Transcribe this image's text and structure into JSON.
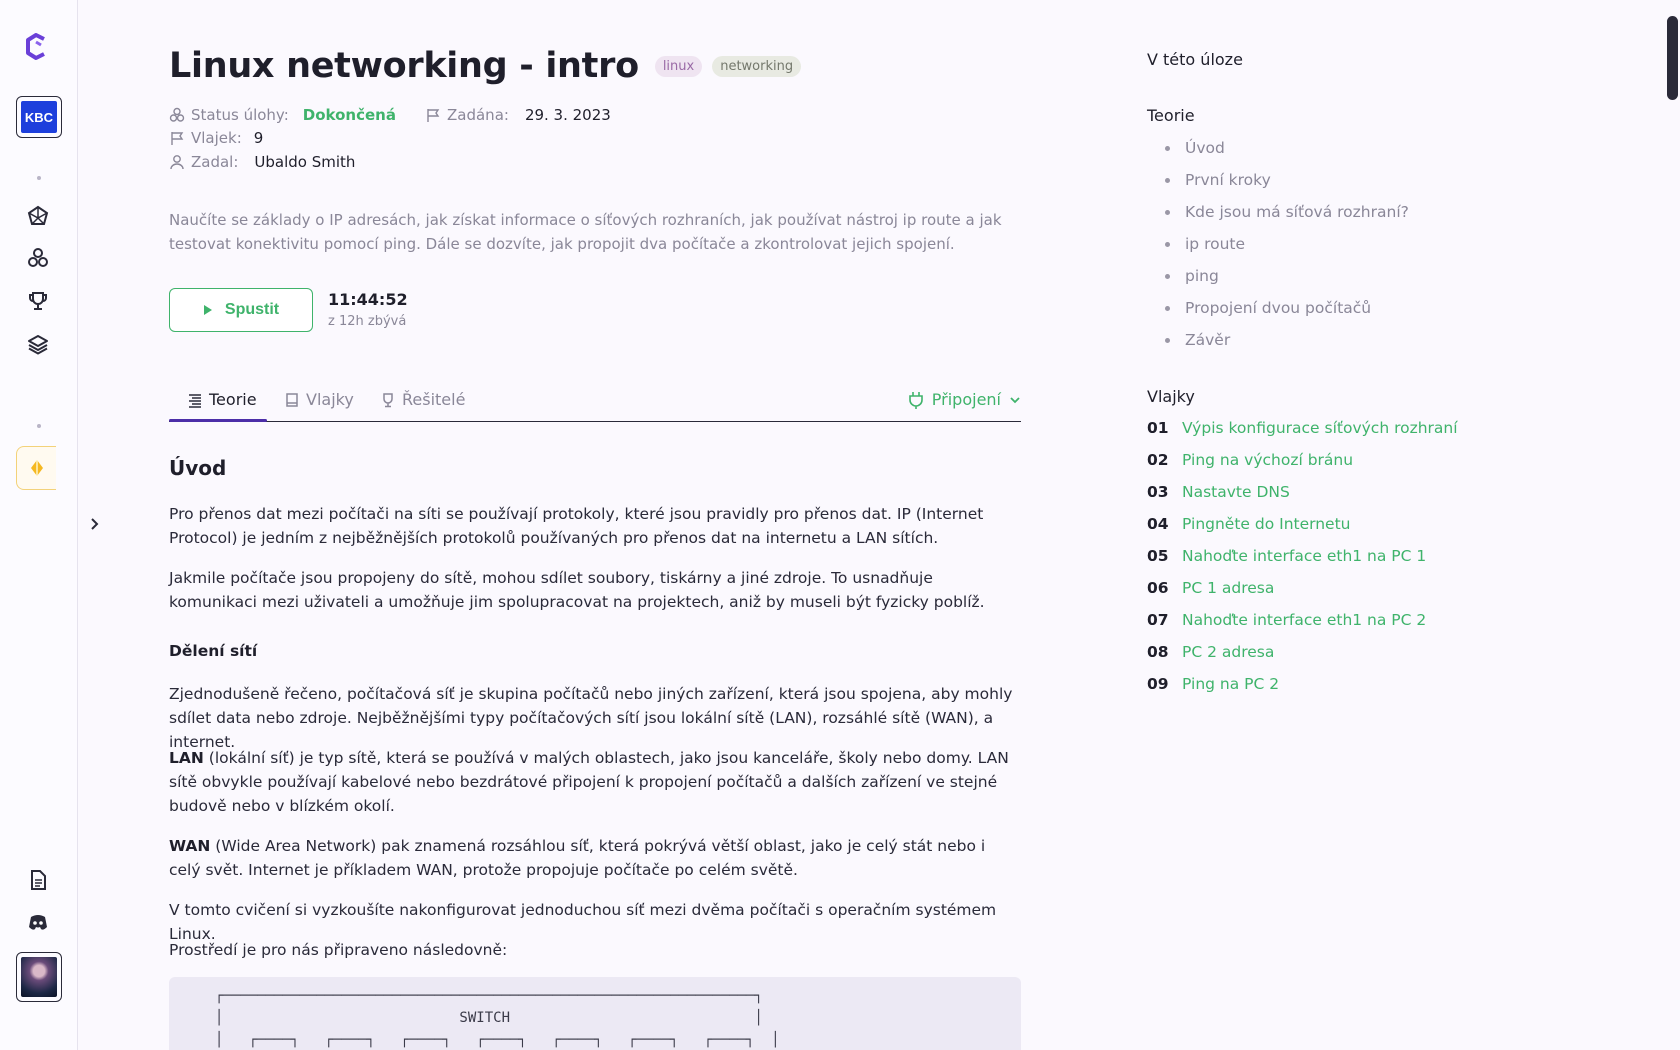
{
  "rail": {
    "org_logo_text": "KBC",
    "icons": [
      "logo-icon",
      "dashboard-icon",
      "cluster-icon",
      "trophy-icon",
      "layers-icon",
      "gem-icon",
      "document-icon",
      "discord-icon"
    ]
  },
  "task": {
    "title": "Linux networking - intro",
    "tags": [
      "linux",
      "networking"
    ],
    "status_label": "Status úlohy:",
    "status_value": "Dokončená",
    "assigned_label": "Zadána:",
    "assigned_value": "29. 3. 2023",
    "flags_label": "Vlajek:",
    "flags_value": "9",
    "author_label": "Zadal:",
    "author_value": "Ubaldo Smith",
    "description": "Naučíte se základy o IP adresách, jak získat informace o síťových rozhraních, jak používat nástroj ip route a jak testovat konektivitu pomocí ping. Dále se dozvíte, jak propojit dva počítače a zkontrolovat jejich spojení.",
    "run_label": "Spustit",
    "timer": "11:44:52",
    "timer_sub": "z 12h zbývá"
  },
  "tabs": {
    "theory": "Teorie",
    "flags": "Vlajky",
    "solvers": "Řešitelé",
    "connection": "Připojení"
  },
  "content": {
    "h_intro": "Úvod",
    "p1": "Pro přenos dat mezi počítači na síti se používají protokoly, které jsou pravidly pro přenos dat. IP (Internet Protocol) je jedním z nejběžnějších protokolů používaných pro přenos dat na internetu a LAN sítích.",
    "p2": "Jakmile počítače jsou propojeny do sítě, mohou sdílet soubory, tiskárny a jiné zdroje. To usnadňuje komunikaci mezi uživateli a umožňuje jim spolupracovat na projektech, aniž by museli být fyzicky poblíž.",
    "h_division": "Dělení sítí",
    "p3": "Zjednodušeně řečeno, počítačová síť je skupina počítačů nebo jiných zařízení, která jsou spojena, aby mohly sdílet data nebo zdroje. Nejběžnějšími typy počítačových sítí jsou lokální sítě (LAN), rozsáhlé sítě (WAN), a internet.",
    "p4_bold": "LAN",
    "p4_rest": " (lokální síť) je typ sítě, která se používá v malých oblastech, jako jsou kanceláře, školy nebo domy. LAN sítě obvykle používají kabelové nebo bezdrátové připojení k propojení počítačů a dalších zařízení ve stejné budově nebo v blízkém okolí.",
    "p5_bold": "WAN",
    "p5_rest": " (Wide Area Network) pak znamená rozsáhlou síť, která pokrývá větší oblast, jako je celý stát nebo i celý svět. Internet je příkladem WAN, protože propojuje počítače po celém světě.",
    "p6": "V tomto cvičení si vyzkoušíte nakonfigurovat jednoduchou síť mezi dvěma počítači s operačním systémem Linux.",
    "p7": "Prostředí je pro nás připraveno následovně:",
    "code": "┌───────────────────────────────────────────────────────────────┐\n│                            SWITCH                             │\n│   ┌────┐   ┌────┐   ┌────┐   ┌────┐   ┌────┐   ┌────┐   ┌────┐  │"
  },
  "toc": {
    "heading": "V této úloze",
    "theory_heading": "Teorie",
    "theory_items": [
      "Úvod",
      "První kroky",
      "Kde jsou má síťová rozhraní?",
      "ip route",
      "ping",
      "Propojení dvou počítačů",
      "Závěr"
    ],
    "flags_heading": "Vlajky",
    "flag_items": [
      {
        "num": "01",
        "name": "Výpis konfigurace síťových rozhraní"
      },
      {
        "num": "02",
        "name": "Ping na výchozí bránu"
      },
      {
        "num": "03",
        "name": "Nastavte DNS"
      },
      {
        "num": "04",
        "name": "Pingněte do Internetu"
      },
      {
        "num": "05",
        "name": "Nahoďte interface eth1 na PC 1"
      },
      {
        "num": "06",
        "name": "PC 1 adresa"
      },
      {
        "num": "07",
        "name": "Nahoďte interface eth1 na PC 2"
      },
      {
        "num": "08",
        "name": "PC 2 adresa"
      },
      {
        "num": "09",
        "name": "Ping na PC 2"
      }
    ]
  },
  "colors": {
    "accent_green": "#3fb36b",
    "accent_purple": "#4c2ea8",
    "background": "#fbf9fe"
  }
}
